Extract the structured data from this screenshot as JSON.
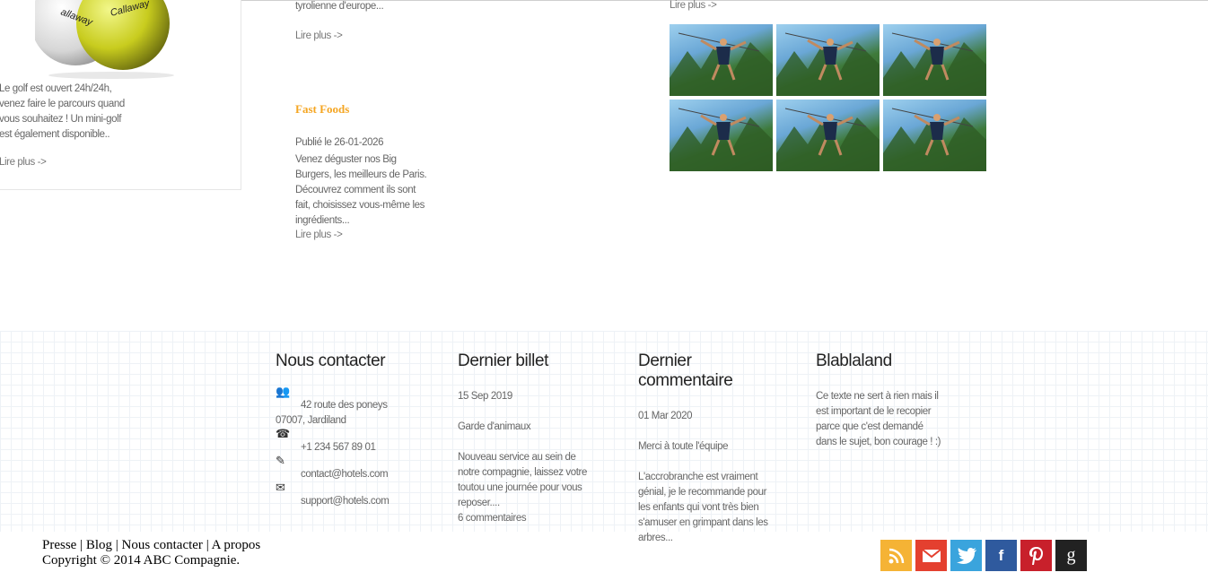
{
  "golf": {
    "text": "Le golf est ouvert 24h/24h, venez faire le parcours quand vous souhaitez ! Un mini-golf est également disponible..",
    "more": "Lire plus ->"
  },
  "middle": {
    "partial_text": "tyrolienne d'europe...",
    "more1": "Lire plus ->",
    "post_title": "Fast Foods",
    "post_date": "Publié le 26-01-2026",
    "post_text": "Venez déguster nos Big Burgers, les meilleurs de Paris. Découvrez comment ils sont fait, choisissez vous-même les ingrédients...",
    "more2": "Lire plus ->"
  },
  "gallery": {
    "more": "Lire plus ->"
  },
  "footer": {
    "contact": {
      "title": "Nous contacter",
      "address_line1": "42 route des poneys",
      "address_line2": "07007, Jardiland",
      "phone": "+1 234 567 89 01",
      "email1": "contact@hotels.com",
      "email2": "support@hotels.com"
    },
    "last_post": {
      "title": "Dernier billet",
      "date": "15 Sep 2019",
      "post_title": "Garde d'animaux",
      "text": "Nouveau service au sein de notre compagnie, laissez votre toutou une journée pour vous reposer....",
      "comments": "6 commentaires"
    },
    "last_comment": {
      "title": "Dernier commentaire",
      "date": "01 Mar 2020",
      "post_title": "Merci à toute l'équipe",
      "text": "L'accrobranche est vraiment génial, je le recommande pour les enfants qui vont très bien s'amuser en grimpant dans les arbres..."
    },
    "blabla": {
      "title": "Blablaland",
      "text": "Ce texte ne sert à rien mais il est important de le recopier parce que c'est demandé dans le sujet, bon courage ! :)"
    }
  },
  "bottom": {
    "links": [
      "Presse",
      "Blog",
      "Nous contacter",
      "A propos"
    ],
    "separator": "|",
    "copyright": "Copyright © 2014 ABC Compagnie."
  },
  "social": [
    {
      "icon": "rss-icon",
      "color": "#f5b335",
      "glyph": "◣"
    },
    {
      "icon": "mail-icon",
      "color": "#e4402f",
      "glyph": "✉"
    },
    {
      "icon": "twitter-icon",
      "color": "#3aa4dd",
      "glyph": "🐦"
    },
    {
      "icon": "facebook-icon",
      "color": "#2f5a9e",
      "glyph": "f"
    },
    {
      "icon": "pinterest-icon",
      "color": "#c8202b",
      "glyph": "P"
    },
    {
      "icon": "google-icon",
      "color": "#222222",
      "glyph": "g"
    }
  ]
}
